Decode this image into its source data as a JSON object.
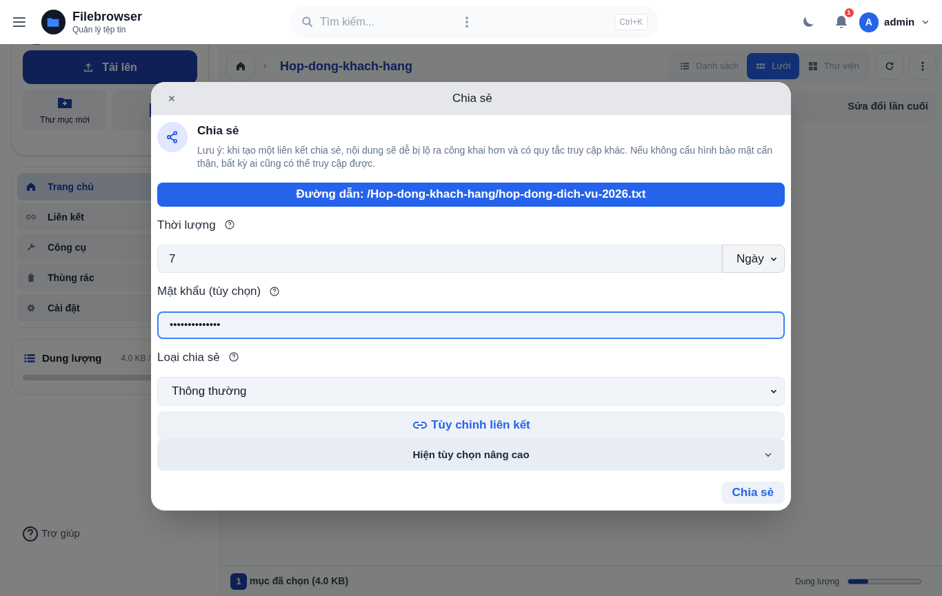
{
  "header": {
    "app_name": "Filebrowser",
    "app_subtitle": "Quản lý tệp tin",
    "search": {
      "placeholder": "Tìm kiếm..."
    },
    "shortcut": "Ctrl+K",
    "notifications": "1",
    "avatar": "A",
    "user": "admin"
  },
  "sidebar": {
    "upload": "Tải lên",
    "quick_actions": [
      "Thư mục mới"
    ],
    "nav": [
      {
        "label": "Trang chủ",
        "selected": true
      },
      {
        "label": "Liên kết",
        "selected": false
      },
      {
        "label": "Công cụ",
        "selected": false
      },
      {
        "label": "Thùng rác",
        "selected": false
      },
      {
        "label": "Cài đặt",
        "selected": false
      }
    ],
    "storage": {
      "label": "Dung lượng",
      "reading": "4.0 KB /"
    },
    "help": "Trợ giúp"
  },
  "content": {
    "breadcrumb": "Hop-dong-khach-hang",
    "views": [
      {
        "label": "Danh sách",
        "selected": false
      },
      {
        "label": "Lưới",
        "selected": true
      },
      {
        "label": "Thư viện",
        "selected": false
      }
    ],
    "columns": [
      "Sửa đổi lần cuối"
    ],
    "status": {
      "count": "1",
      "text": "mục đã chọn (4.0 KB)",
      "size_label": "Dung lượng",
      "size_slider": {
        "level": 0.28
      }
    }
  },
  "modal": {
    "title": "Chia sẻ",
    "heading": "Chia sẻ",
    "note": "Lưu ý: khi tạo một liên kết chia sẻ, nội dung sẽ dễ bị lộ ra công khai hơn và có quy tắc truy cập khác. Nếu không cấu hình bảo mật cẩn thận, bất kỳ ai cũng có thể truy cập được.",
    "path": "Đường dẫn: /Hop-dong-khach-hang/hop-dong-dich-vu-2026.txt",
    "duration": {
      "label": "Thời lượng",
      "value": "7",
      "unit": "Ngày"
    },
    "password": {
      "label": "Mật khẩu (tùy chọn)",
      "value": "••••••••••••••",
      "focused": true
    },
    "share_type": {
      "label": "Loại chia sẻ",
      "value": "Thông thường"
    },
    "custom_link": "Tùy chỉnh liên kết",
    "advanced": {
      "label": "Hiện tùy chọn nâng cao",
      "expanded": false
    },
    "submit": "Chia sẻ"
  }
}
